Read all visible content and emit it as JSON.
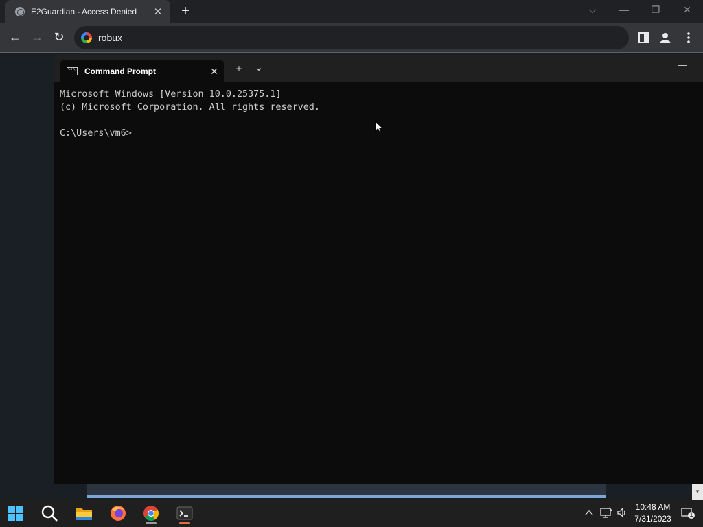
{
  "browser": {
    "tab_title": "E2Guardian - Access Denied",
    "tab_close": "✕",
    "new_tab": "+",
    "omnibox_text": "robux",
    "window_controls": {
      "dropdown": "⌵",
      "minimize": "—",
      "restore": "❐",
      "close": "✕"
    },
    "nav": {
      "back": "←",
      "forward": "→",
      "reload": "↻"
    }
  },
  "terminal": {
    "tab_title": "Command Prompt",
    "tab_close": "✕",
    "new_tab": "+",
    "dropdown": "⌄",
    "minimize": "—",
    "lines": [
      "Microsoft Windows [Version 10.0.25375.1]",
      "(c) Microsoft Corporation. All rights reserved.",
      "",
      "C:\\Users\\vm6>"
    ]
  },
  "taskbar": {
    "apps": [
      "start-icon",
      "search-icon",
      "file-explorer-icon",
      "firefox-icon",
      "chrome-icon",
      "terminal-icon"
    ],
    "tray": {
      "chevron": "^",
      "notification_count": "1"
    },
    "clock": {
      "time": "10:48 AM",
      "date": "7/31/2023"
    }
  },
  "colors": {
    "desktop": "#1a1e25",
    "terminal_bg": "#0c0c0c",
    "terminal_text": "#cccccc",
    "chrome_frame": "#202124",
    "chrome_toolbar": "#35363a"
  }
}
